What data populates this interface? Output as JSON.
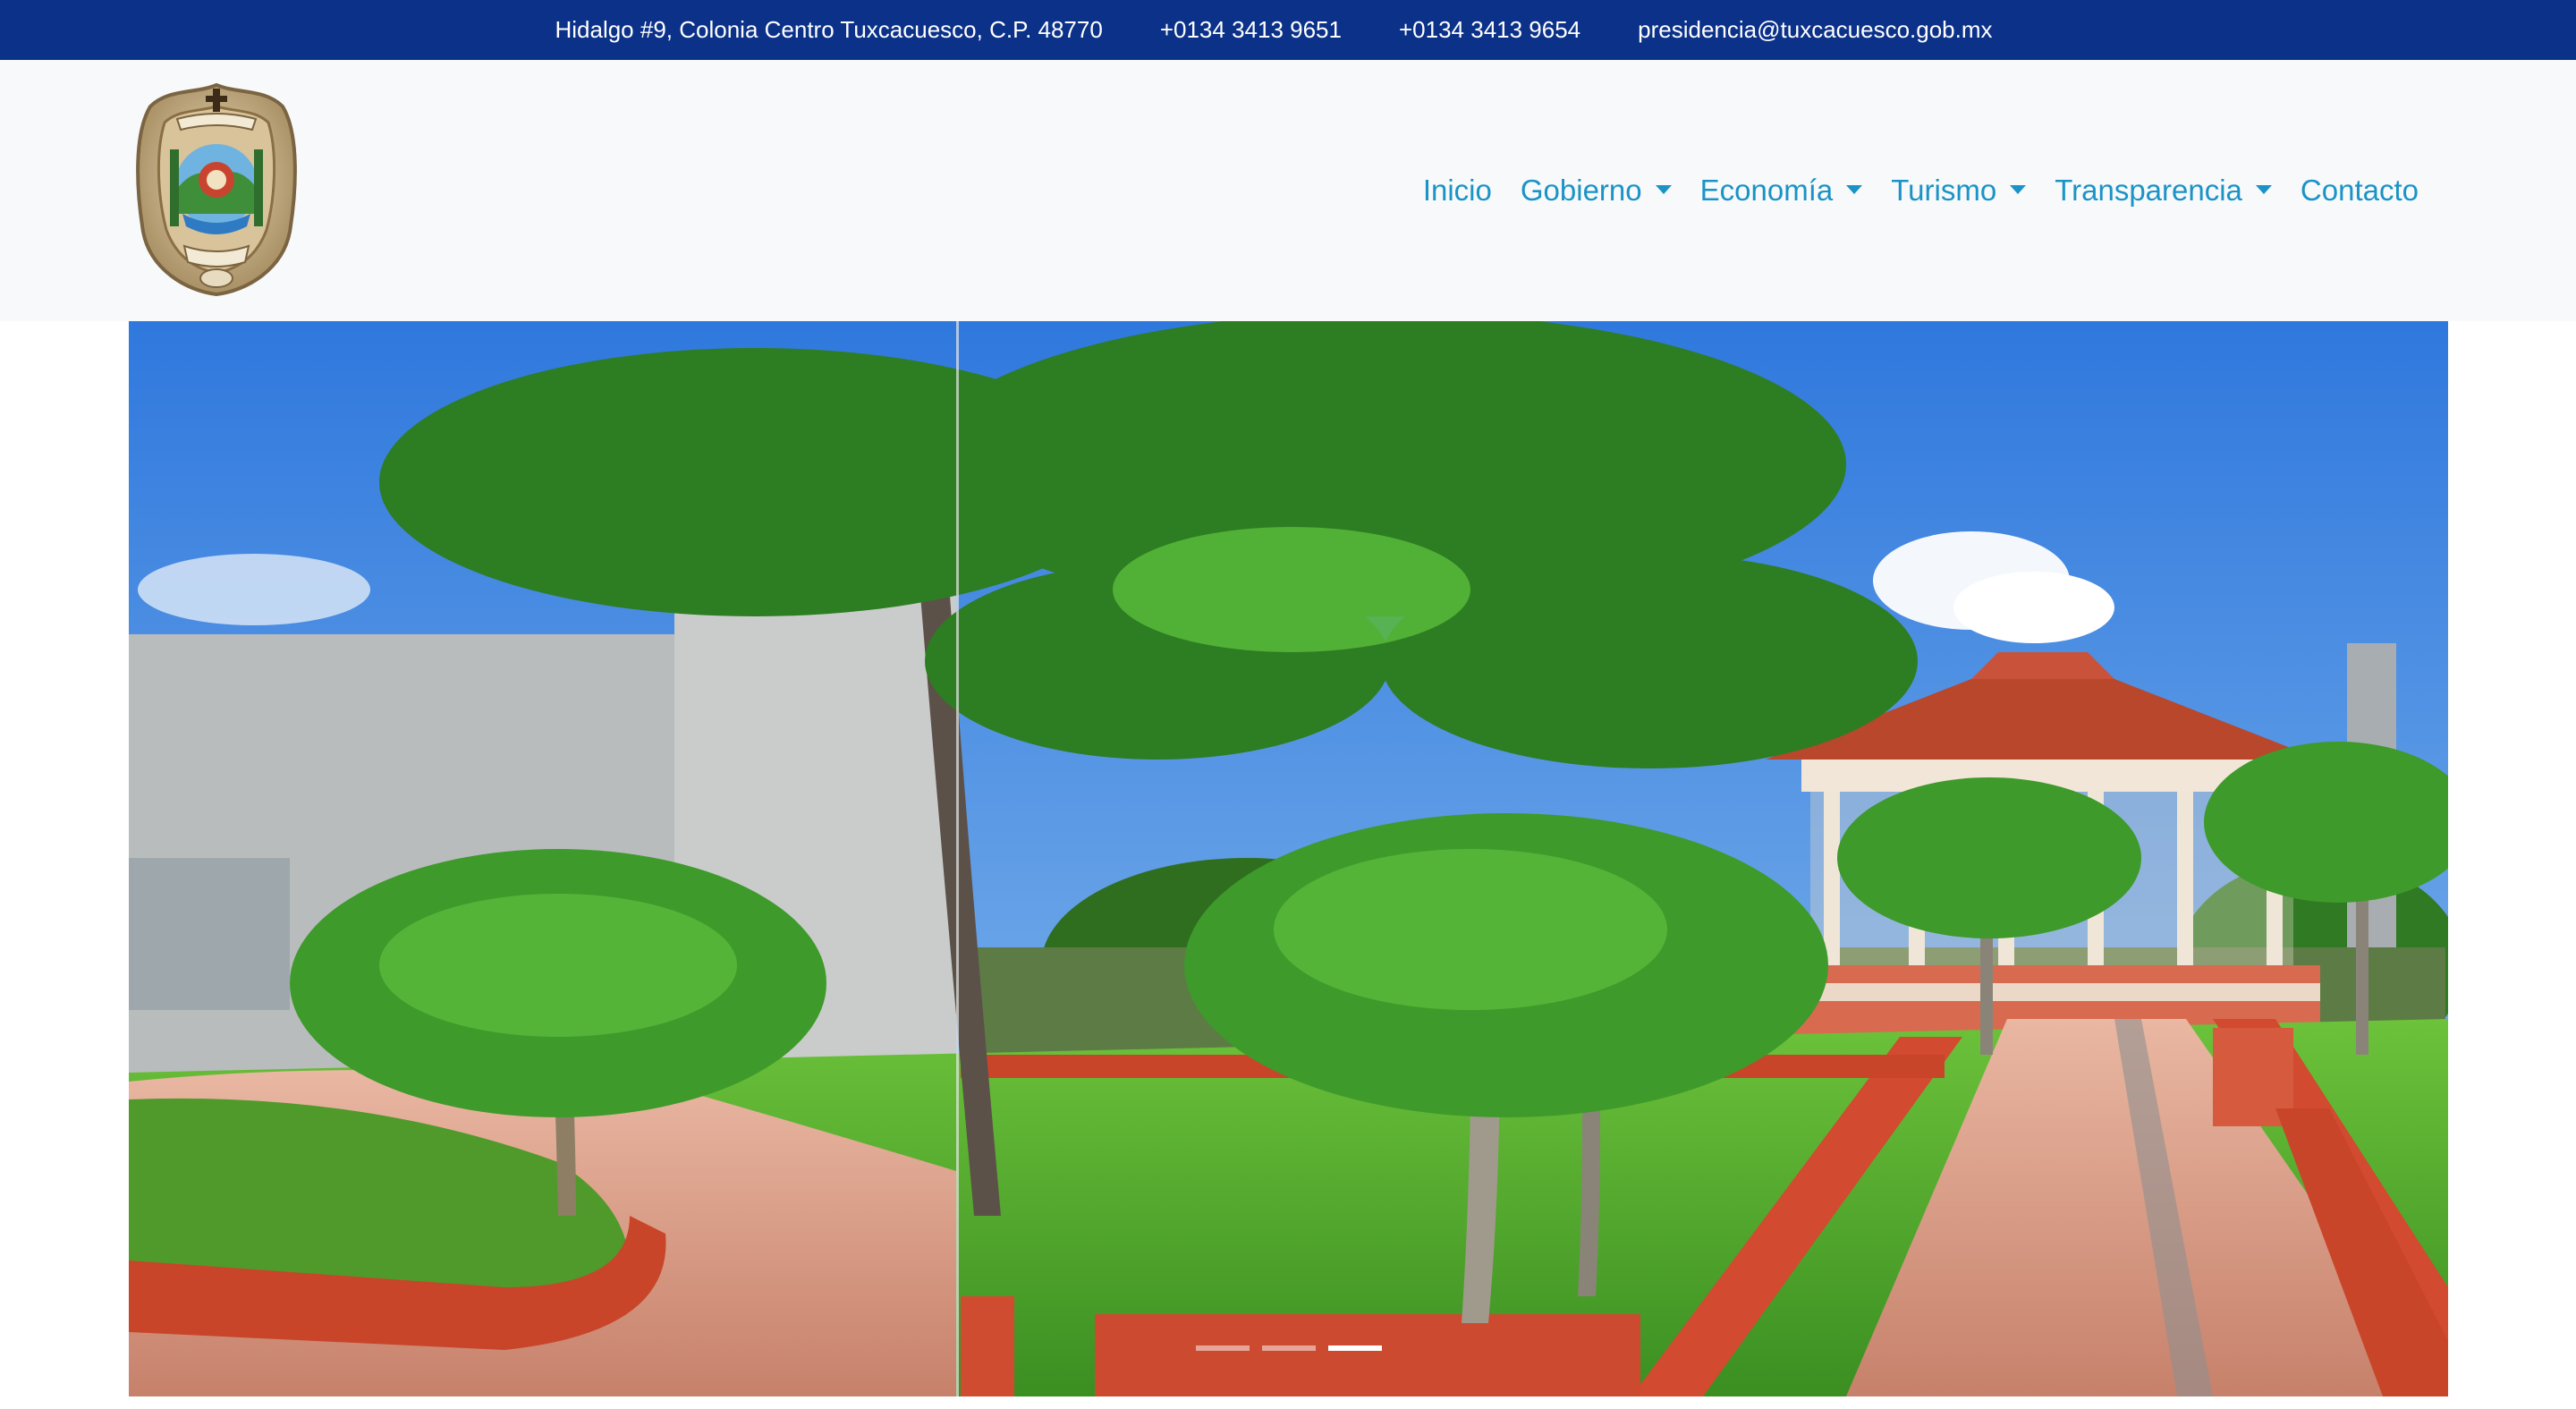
{
  "topbar": {
    "address": "Hidalgo #9, Colonia Centro Tuxcacuesco, C.P. 48770",
    "phone_1": "+0134 3413 9651",
    "phone_2": "+0134 3413 9654",
    "email": "presidencia@tuxcacuesco.gob.mx",
    "background": "#0b3189"
  },
  "navbar": {
    "logo_icon": "municipal-coat-of-arms",
    "link_color": "#1a93c7",
    "items": [
      {
        "label": "Inicio",
        "dropdown": false
      },
      {
        "label": "Gobierno",
        "dropdown": true
      },
      {
        "label": "Economía",
        "dropdown": true
      },
      {
        "label": "Turismo",
        "dropdown": true
      },
      {
        "label": "Transparencia",
        "dropdown": true
      },
      {
        "label": "Contacto",
        "dropdown": false
      }
    ]
  },
  "carousel": {
    "slide_count": 3,
    "active_index": 2,
    "scene": "town plaza with palm trees, red curbs and gazebo"
  }
}
